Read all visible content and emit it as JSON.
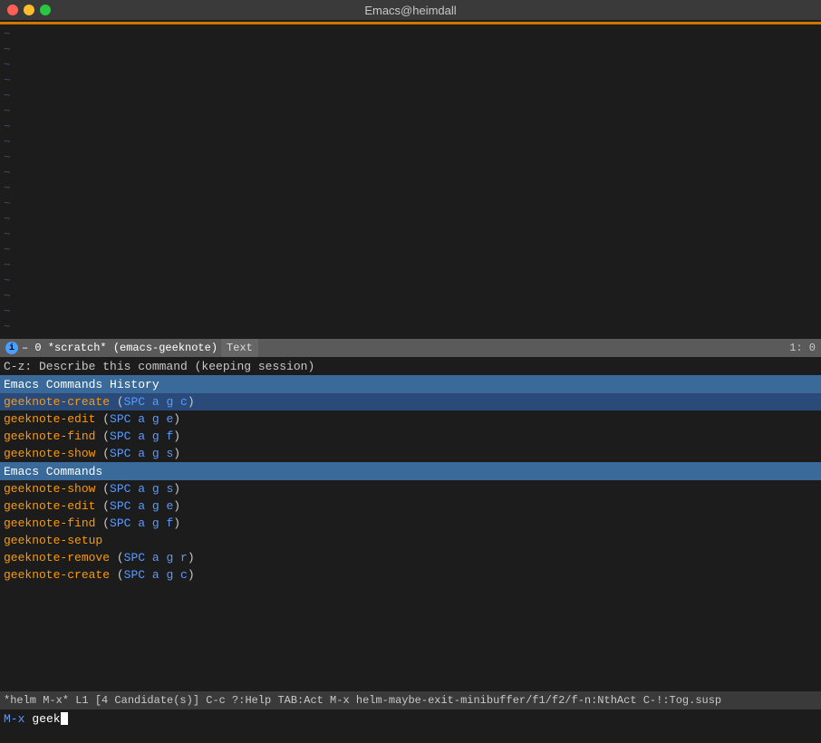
{
  "titlebar": {
    "title": "Emacs@heimdall"
  },
  "editor": {
    "tilde_count": 20
  },
  "modeline": {
    "info_icon": "i",
    "buffer_text": "– 0  *scratch*  (emacs-geeknote)",
    "mode_text": "Text",
    "position": "1: 0"
  },
  "echo": {
    "text": "C-z: Describe this command (keeping session)"
  },
  "helm": {
    "history_header": "Emacs Commands History",
    "history_candidates": [
      {
        "name": "geeknote-create",
        "keys": "SPC a g c",
        "selected": true
      },
      {
        "name": "geeknote-edit",
        "keys": "SPC a g e",
        "selected": false
      },
      {
        "name": "geeknote-find",
        "keys": "SPC a g f",
        "selected": false
      },
      {
        "name": "geeknote-show",
        "keys": "SPC a g s",
        "selected": false
      }
    ],
    "commands_header": "Emacs Commands",
    "commands_candidates": [
      {
        "name": "geeknote-show",
        "keys": "SPC a g s"
      },
      {
        "name": "geeknote-edit",
        "keys": "SPC a g e"
      },
      {
        "name": "geeknote-find",
        "keys": "SPC a g f"
      },
      {
        "name": "geeknote-setup",
        "keys": null
      },
      {
        "name": "geeknote-remove",
        "keys": "SPC a g r"
      },
      {
        "name": "geeknote-create",
        "keys": "SPC a g c"
      }
    ]
  },
  "bottombar": {
    "text": "*helm M-x*  L1  [4 Candidate(s)]  C-c ?:Help  TAB:Act  M-x helm-maybe-exit-minibuffer/f1/f2/f-n:NthAct  C-!:Tog.susp"
  },
  "minibuffer": {
    "prompt": "M-x",
    "input": "geek"
  },
  "helm_indicator": "*helm M-x*"
}
